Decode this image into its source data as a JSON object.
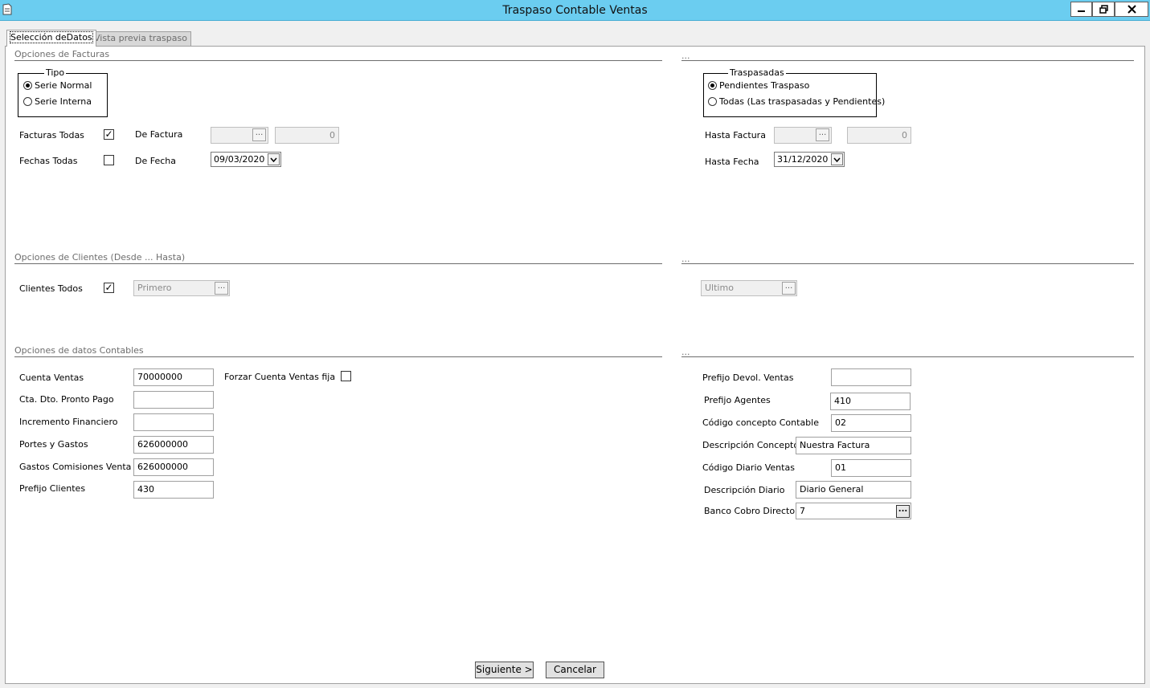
{
  "window": {
    "title": "Traspaso Contable Ventas",
    "minimize_glyph": "−",
    "restore_glyph": "❐",
    "close_glyph": "✕"
  },
  "tabs": [
    {
      "label": "Selección deDatos",
      "active": true
    },
    {
      "label": "Vista previa traspaso",
      "active": false
    }
  ],
  "facturas": {
    "section_left": "Opciones de Facturas",
    "section_right": "...",
    "tipo": {
      "title": "Tipo",
      "options": [
        {
          "label": "Serie Normal",
          "selected": true
        },
        {
          "label": "Serie Interna",
          "selected": false
        }
      ]
    },
    "traspasadas": {
      "title": "Traspasadas",
      "options": [
        {
          "label": "Pendientes Traspaso",
          "selected": true
        },
        {
          "label": "Todas (Las traspasadas y Pendientes)",
          "selected": false
        }
      ]
    },
    "facturas_todas_label": "Facturas Todas",
    "facturas_todas_checked": true,
    "fechas_todas_label": "Fechas Todas",
    "fechas_todas_checked": false,
    "de_factura_label": "De Factura",
    "de_factura_serie": "",
    "de_factura_numero": "0",
    "de_fecha_label": "De Fecha",
    "de_fecha_value": "09/03/2020",
    "hasta_factura_label": "Hasta Factura",
    "hasta_factura_serie": "",
    "hasta_factura_numero": "0",
    "hasta_fecha_label": "Hasta Fecha",
    "hasta_fecha_value": "31/12/2020",
    "browse_glyph": "..."
  },
  "clientes": {
    "section_left": "Opciones de Clientes (Desde ... Hasta)",
    "section_right": "...",
    "clientes_todos_label": "Clientes Todos",
    "clientes_todos_checked": true,
    "primero_value": "Primero",
    "ultimo_value": "Ultimo"
  },
  "contables": {
    "section_left": "Opciones de datos Contables",
    "section_right": "...",
    "left_fields": [
      {
        "label": "Cuenta Ventas",
        "value": "70000000"
      },
      {
        "label": "Cta. Dto. Pronto Pago",
        "value": ""
      },
      {
        "label": "Incremento Financiero",
        "value": ""
      },
      {
        "label": "Portes y Gastos",
        "value": "626000000"
      },
      {
        "label": "Gastos Comisiones Venta",
        "value": "626000000"
      },
      {
        "label": "Prefijo Clientes",
        "value": "430"
      }
    ],
    "forzar_label": "Forzar Cuenta Ventas fija",
    "forzar_checked": false,
    "right_fields": [
      {
        "label": "Prefijo Devol. Ventas",
        "value": ""
      },
      {
        "label": "Prefijo Agentes",
        "value": "410"
      },
      {
        "label": "Código concepto Contable",
        "value": "02"
      },
      {
        "label": "Descripción Concepto",
        "value": "Nuestra Factura"
      },
      {
        "label": "Código Diario Ventas",
        "value": "01"
      },
      {
        "label": "Descripción Diario",
        "value": "Diario General"
      },
      {
        "label": "Banco Cobro Directo",
        "value": "7"
      }
    ]
  },
  "footer": {
    "next_label": "Siguiente >",
    "cancel_label": "Cancelar"
  },
  "icons": {
    "check_glyph": "✓",
    "dropdown_glyph": "▾"
  }
}
